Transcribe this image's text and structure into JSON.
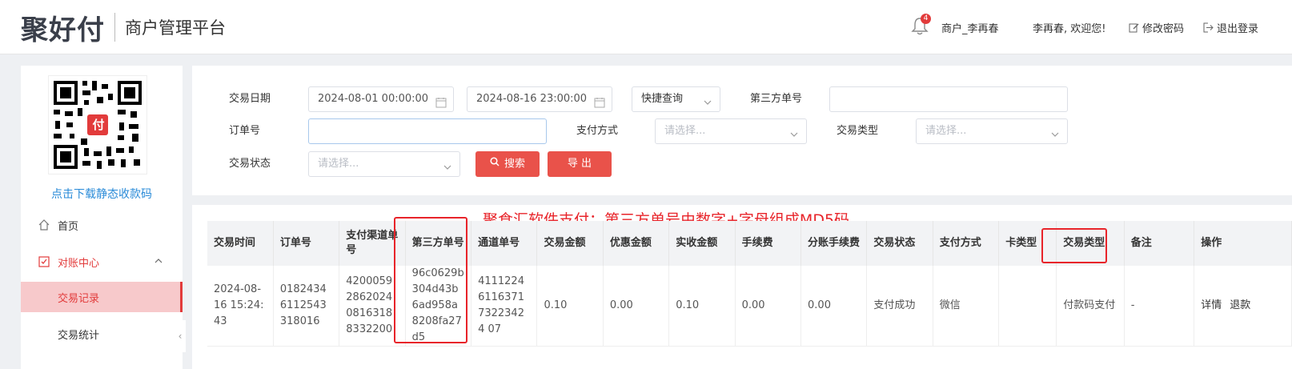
{
  "header": {
    "logo": "聚好付",
    "subtitle": "商户管理平台",
    "notification_count": "4",
    "merchant": "商户_李再春",
    "welcome": "李再春, 欢迎您!",
    "change_password": "修改密码",
    "logout": "退出登录"
  },
  "sidebar": {
    "qr_link": "点击下载静态收款码",
    "qr_center": "付",
    "items": [
      {
        "label": "首页"
      },
      {
        "label": "对账中心"
      },
      {
        "label": "交易记录"
      },
      {
        "label": "交易统计"
      }
    ]
  },
  "search": {
    "date_label": "交易日期",
    "date_start": "2024-08-01 00:00:00",
    "date_end": "2024-08-16 23:00:00",
    "quick_query": "快捷查询",
    "third_party_label": "第三方单号",
    "third_party_value": "",
    "order_label": "订单号",
    "order_value": "",
    "pay_method_label": "支付方式",
    "pay_method_placeholder": "请选择...",
    "trade_type_label": "交易类型",
    "trade_type_placeholder": "请选择...",
    "status_label": "交易状态",
    "status_placeholder": "请选择...",
    "search_button": "搜索",
    "export_button": "导 出"
  },
  "annotation": "聚食汇软件支付：第三方单号由数字+字母组成MD5码",
  "table": {
    "headers": [
      "交易时间",
      "订单号",
      "支付渠道单号",
      "第三方单号",
      "通道单号",
      "交易金额",
      "优惠金额",
      "实收金额",
      "手续费",
      "分账手续费",
      "交易状态",
      "支付方式",
      "卡类型",
      "交易类型",
      "备注",
      "操作"
    ],
    "rows": [
      {
        "time": "2024-08-16 15:24:43",
        "order_no": "01824346112543318016",
        "channel_no": "4200059286202408163188332200",
        "third_party_no": "96c0629b304d43b6ad958a8208fa27d5",
        "pass_no": "4111224611637173223424 07",
        "amount": "0.10",
        "discount": "0.00",
        "received": "0.10",
        "fee": "0.00",
        "split_fee": "0.00",
        "status": "支付成功",
        "pay_method": "微信",
        "card_type": "",
        "trade_type": "付款码支付",
        "remark": "-",
        "op_detail": "详情",
        "op_refund": "退款"
      }
    ]
  },
  "colors": {
    "accent": "#e23b3b",
    "button": "#e9524a",
    "link": "#2a8bd8",
    "highlight": "#e8242a"
  }
}
